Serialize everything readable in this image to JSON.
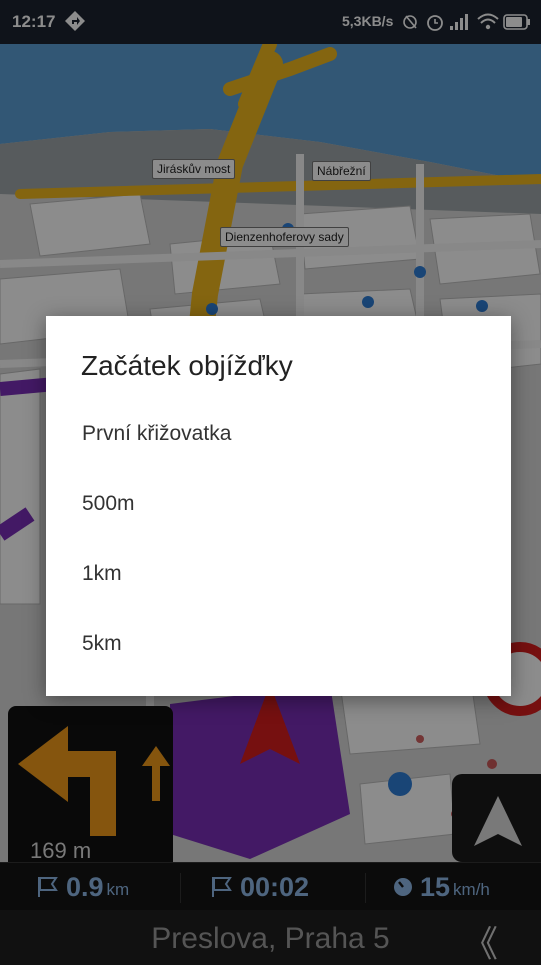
{
  "status_bar": {
    "time": "12:17",
    "net_speed": "5,3KB/s",
    "battery": "83"
  },
  "map": {
    "labels": [
      "Jiráskův most",
      "Nábřežní",
      "Dienzenhoferovy sady"
    ]
  },
  "turn_panel": {
    "distance": "169 m"
  },
  "info_bar": {
    "remaining_distance": "0.9",
    "remaining_distance_unit": "km",
    "remaining_time": "00:02",
    "speed": "15",
    "speed_unit": "km/h"
  },
  "street_bar": {
    "street_name": "Preslova, Praha 5",
    "back_label": "《"
  },
  "dialog": {
    "title": "Začátek objížďky",
    "options": [
      "První křižovatka",
      "500m",
      "1km",
      "5km"
    ]
  },
  "colors": {
    "route": "#7a2fb8",
    "road_major": "#f1b91e",
    "water": "#5b9fd6",
    "info_text": "#8eb9e8",
    "turn_arrow": "#f29c1b"
  }
}
